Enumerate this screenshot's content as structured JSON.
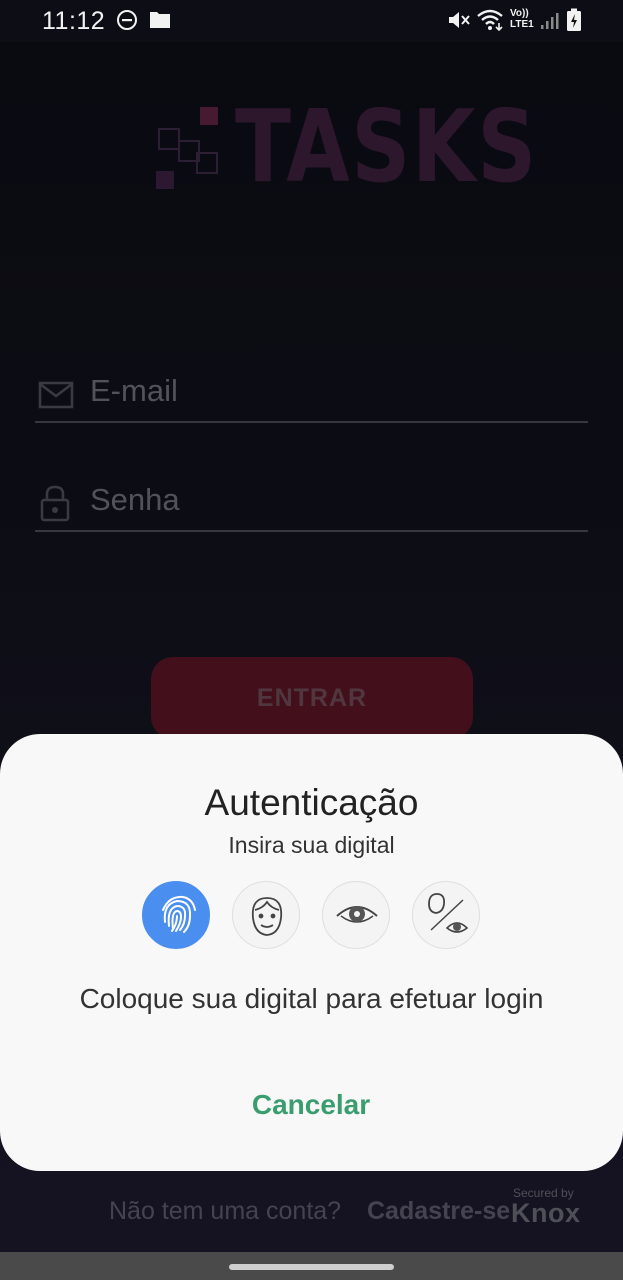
{
  "status_bar": {
    "time": "11:12",
    "left_icons": [
      "do-not-disturb-icon",
      "folder-icon"
    ],
    "right_icons": [
      "mute-icon",
      "wifi-icon",
      "volte-icon",
      "signal-icon",
      "battery-charging-icon"
    ],
    "network_top": "Vo))",
    "network_bottom": "LTE1"
  },
  "logo": {
    "text": "TASKS"
  },
  "login_form": {
    "email_placeholder": "E-mail",
    "password_placeholder": "Senha",
    "submit_label": "ENTRAR"
  },
  "register": {
    "question": "Não tem uma conta?",
    "link_label": "Cadastre-se"
  },
  "knox_badge": {
    "small": "Secured by",
    "big": "Knox"
  },
  "auth_dialog": {
    "title": "Autenticação",
    "subtitle": "Insira sua digital",
    "methods": [
      {
        "name": "fingerprint",
        "active": true
      },
      {
        "name": "face",
        "active": false
      },
      {
        "name": "iris",
        "active": false
      },
      {
        "name": "intelligent-scan",
        "active": false
      }
    ],
    "message": "Coloque sua digital para efetuar login",
    "cancel_label": "Cancelar"
  },
  "colors": {
    "accent_blue": "#4a8ef0",
    "cancel_green": "#3a9d6f",
    "button_red": "#5a1424"
  }
}
